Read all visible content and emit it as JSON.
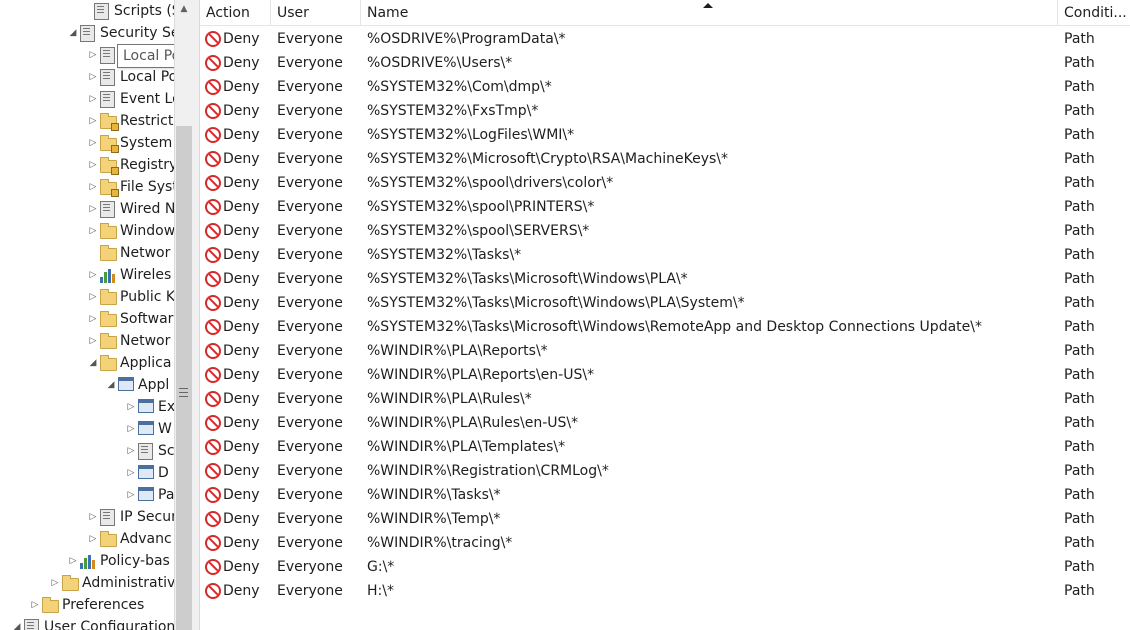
{
  "tree": {
    "items": [
      {
        "label": "Scripts (Sta",
        "expander": "",
        "icon": "book"
      },
      {
        "label": "Security Se",
        "expander": "◢",
        "icon": "lock-book"
      },
      {
        "label": "",
        "expander": "▷",
        "icon": "book"
      },
      {
        "label": "Local Po",
        "expander": "▷",
        "icon": "book"
      },
      {
        "label": "Event Lo",
        "expander": "▷",
        "icon": "book"
      },
      {
        "label": "Restrict",
        "expander": "▷",
        "icon": "lock-folder"
      },
      {
        "label": "System",
        "expander": "▷",
        "icon": "lock-folder"
      },
      {
        "label": "Registry",
        "expander": "▷",
        "icon": "lock-folder"
      },
      {
        "label": "File Syst",
        "expander": "▷",
        "icon": "lock-folder"
      },
      {
        "label": "Wired N",
        "expander": "▷",
        "icon": "book"
      },
      {
        "label": "Window",
        "expander": "▷",
        "icon": "folder"
      },
      {
        "label": "Networ",
        "expander": "",
        "icon": "folder"
      },
      {
        "label": "Wireles",
        "expander": "▷",
        "icon": "chart"
      },
      {
        "label": "Public K",
        "expander": "▷",
        "icon": "folder"
      },
      {
        "label": "Softwar",
        "expander": "▷",
        "icon": "folder"
      },
      {
        "label": "Networ",
        "expander": "▷",
        "icon": "folder"
      },
      {
        "label": "Applica",
        "expander": "◢",
        "icon": "folder"
      },
      {
        "label": "Appl",
        "expander": "◢",
        "icon": "policy"
      },
      {
        "label": "Ex",
        "expander": "▷",
        "icon": "window"
      },
      {
        "label": "W",
        "expander": "▷",
        "icon": "window"
      },
      {
        "label": "Sc",
        "expander": "▷",
        "icon": "book"
      },
      {
        "label": "D",
        "expander": "▷",
        "icon": "window"
      },
      {
        "label": "Pa",
        "expander": "▷",
        "icon": "window"
      },
      {
        "label": "IP Secur",
        "expander": "▷",
        "icon": "lock-book"
      },
      {
        "label": "Advanc",
        "expander": "▷",
        "icon": "folder"
      },
      {
        "label": "Policy-bas",
        "expander": "▷",
        "icon": "chart"
      },
      {
        "label": "Administrativ",
        "expander": "▷",
        "icon": "folder"
      },
      {
        "label": "Preferences",
        "expander": "▷",
        "icon": "folder"
      },
      {
        "label": "User Configuration",
        "expander": "◢",
        "icon": "book"
      }
    ],
    "tooltip": "Local Policies"
  },
  "list": {
    "columns": [
      "Action",
      "User",
      "Name",
      "Conditi..."
    ],
    "rows": [
      {
        "action": "Deny",
        "user": "Everyone",
        "name": "%OSDRIVE%\\ProgramData\\*",
        "condition": "Path"
      },
      {
        "action": "Deny",
        "user": "Everyone",
        "name": "%OSDRIVE%\\Users\\*",
        "condition": "Path"
      },
      {
        "action": "Deny",
        "user": "Everyone",
        "name": "%SYSTEM32%\\Com\\dmp\\*",
        "condition": "Path"
      },
      {
        "action": "Deny",
        "user": "Everyone",
        "name": "%SYSTEM32%\\FxsTmp\\*",
        "condition": "Path"
      },
      {
        "action": "Deny",
        "user": "Everyone",
        "name": "%SYSTEM32%\\LogFiles\\WMI\\*",
        "condition": "Path"
      },
      {
        "action": "Deny",
        "user": "Everyone",
        "name": "%SYSTEM32%\\Microsoft\\Crypto\\RSA\\MachineKeys\\*",
        "condition": "Path"
      },
      {
        "action": "Deny",
        "user": "Everyone",
        "name": "%SYSTEM32%\\spool\\drivers\\color\\*",
        "condition": "Path"
      },
      {
        "action": "Deny",
        "user": "Everyone",
        "name": "%SYSTEM32%\\spool\\PRINTERS\\*",
        "condition": "Path"
      },
      {
        "action": "Deny",
        "user": "Everyone",
        "name": "%SYSTEM32%\\spool\\SERVERS\\*",
        "condition": "Path"
      },
      {
        "action": "Deny",
        "user": "Everyone",
        "name": "%SYSTEM32%\\Tasks\\*",
        "condition": "Path"
      },
      {
        "action": "Deny",
        "user": "Everyone",
        "name": "%SYSTEM32%\\Tasks\\Microsoft\\Windows\\PLA\\*",
        "condition": "Path"
      },
      {
        "action": "Deny",
        "user": "Everyone",
        "name": "%SYSTEM32%\\Tasks\\Microsoft\\Windows\\PLA\\System\\*",
        "condition": "Path"
      },
      {
        "action": "Deny",
        "user": "Everyone",
        "name": "%SYSTEM32%\\Tasks\\Microsoft\\Windows\\RemoteApp and Desktop Connections Update\\*",
        "condition": "Path"
      },
      {
        "action": "Deny",
        "user": "Everyone",
        "name": "%WINDIR%\\PLA\\Reports\\*",
        "condition": "Path"
      },
      {
        "action": "Deny",
        "user": "Everyone",
        "name": "%WINDIR%\\PLA\\Reports\\en-US\\*",
        "condition": "Path"
      },
      {
        "action": "Deny",
        "user": "Everyone",
        "name": "%WINDIR%\\PLA\\Rules\\*",
        "condition": "Path"
      },
      {
        "action": "Deny",
        "user": "Everyone",
        "name": "%WINDIR%\\PLA\\Rules\\en-US\\*",
        "condition": "Path"
      },
      {
        "action": "Deny",
        "user": "Everyone",
        "name": "%WINDIR%\\PLA\\Templates\\*",
        "condition": "Path"
      },
      {
        "action": "Deny",
        "user": "Everyone",
        "name": "%WINDIR%\\Registration\\CRMLog\\*",
        "condition": "Path"
      },
      {
        "action": "Deny",
        "user": "Everyone",
        "name": "%WINDIR%\\Tasks\\*",
        "condition": "Path"
      },
      {
        "action": "Deny",
        "user": "Everyone",
        "name": "%WINDIR%\\Temp\\*",
        "condition": "Path"
      },
      {
        "action": "Deny",
        "user": "Everyone",
        "name": "%WINDIR%\\tracing\\*",
        "condition": "Path"
      },
      {
        "action": "Deny",
        "user": "Everyone",
        "name": "G:\\*",
        "condition": "Path"
      },
      {
        "action": "Deny",
        "user": "Everyone",
        "name": "H:\\*",
        "condition": "Path"
      }
    ]
  },
  "colors": {
    "deny": "#d32a2a",
    "folder": "#f4d27a",
    "scrollbar_thumb": "#cdcdcd"
  }
}
